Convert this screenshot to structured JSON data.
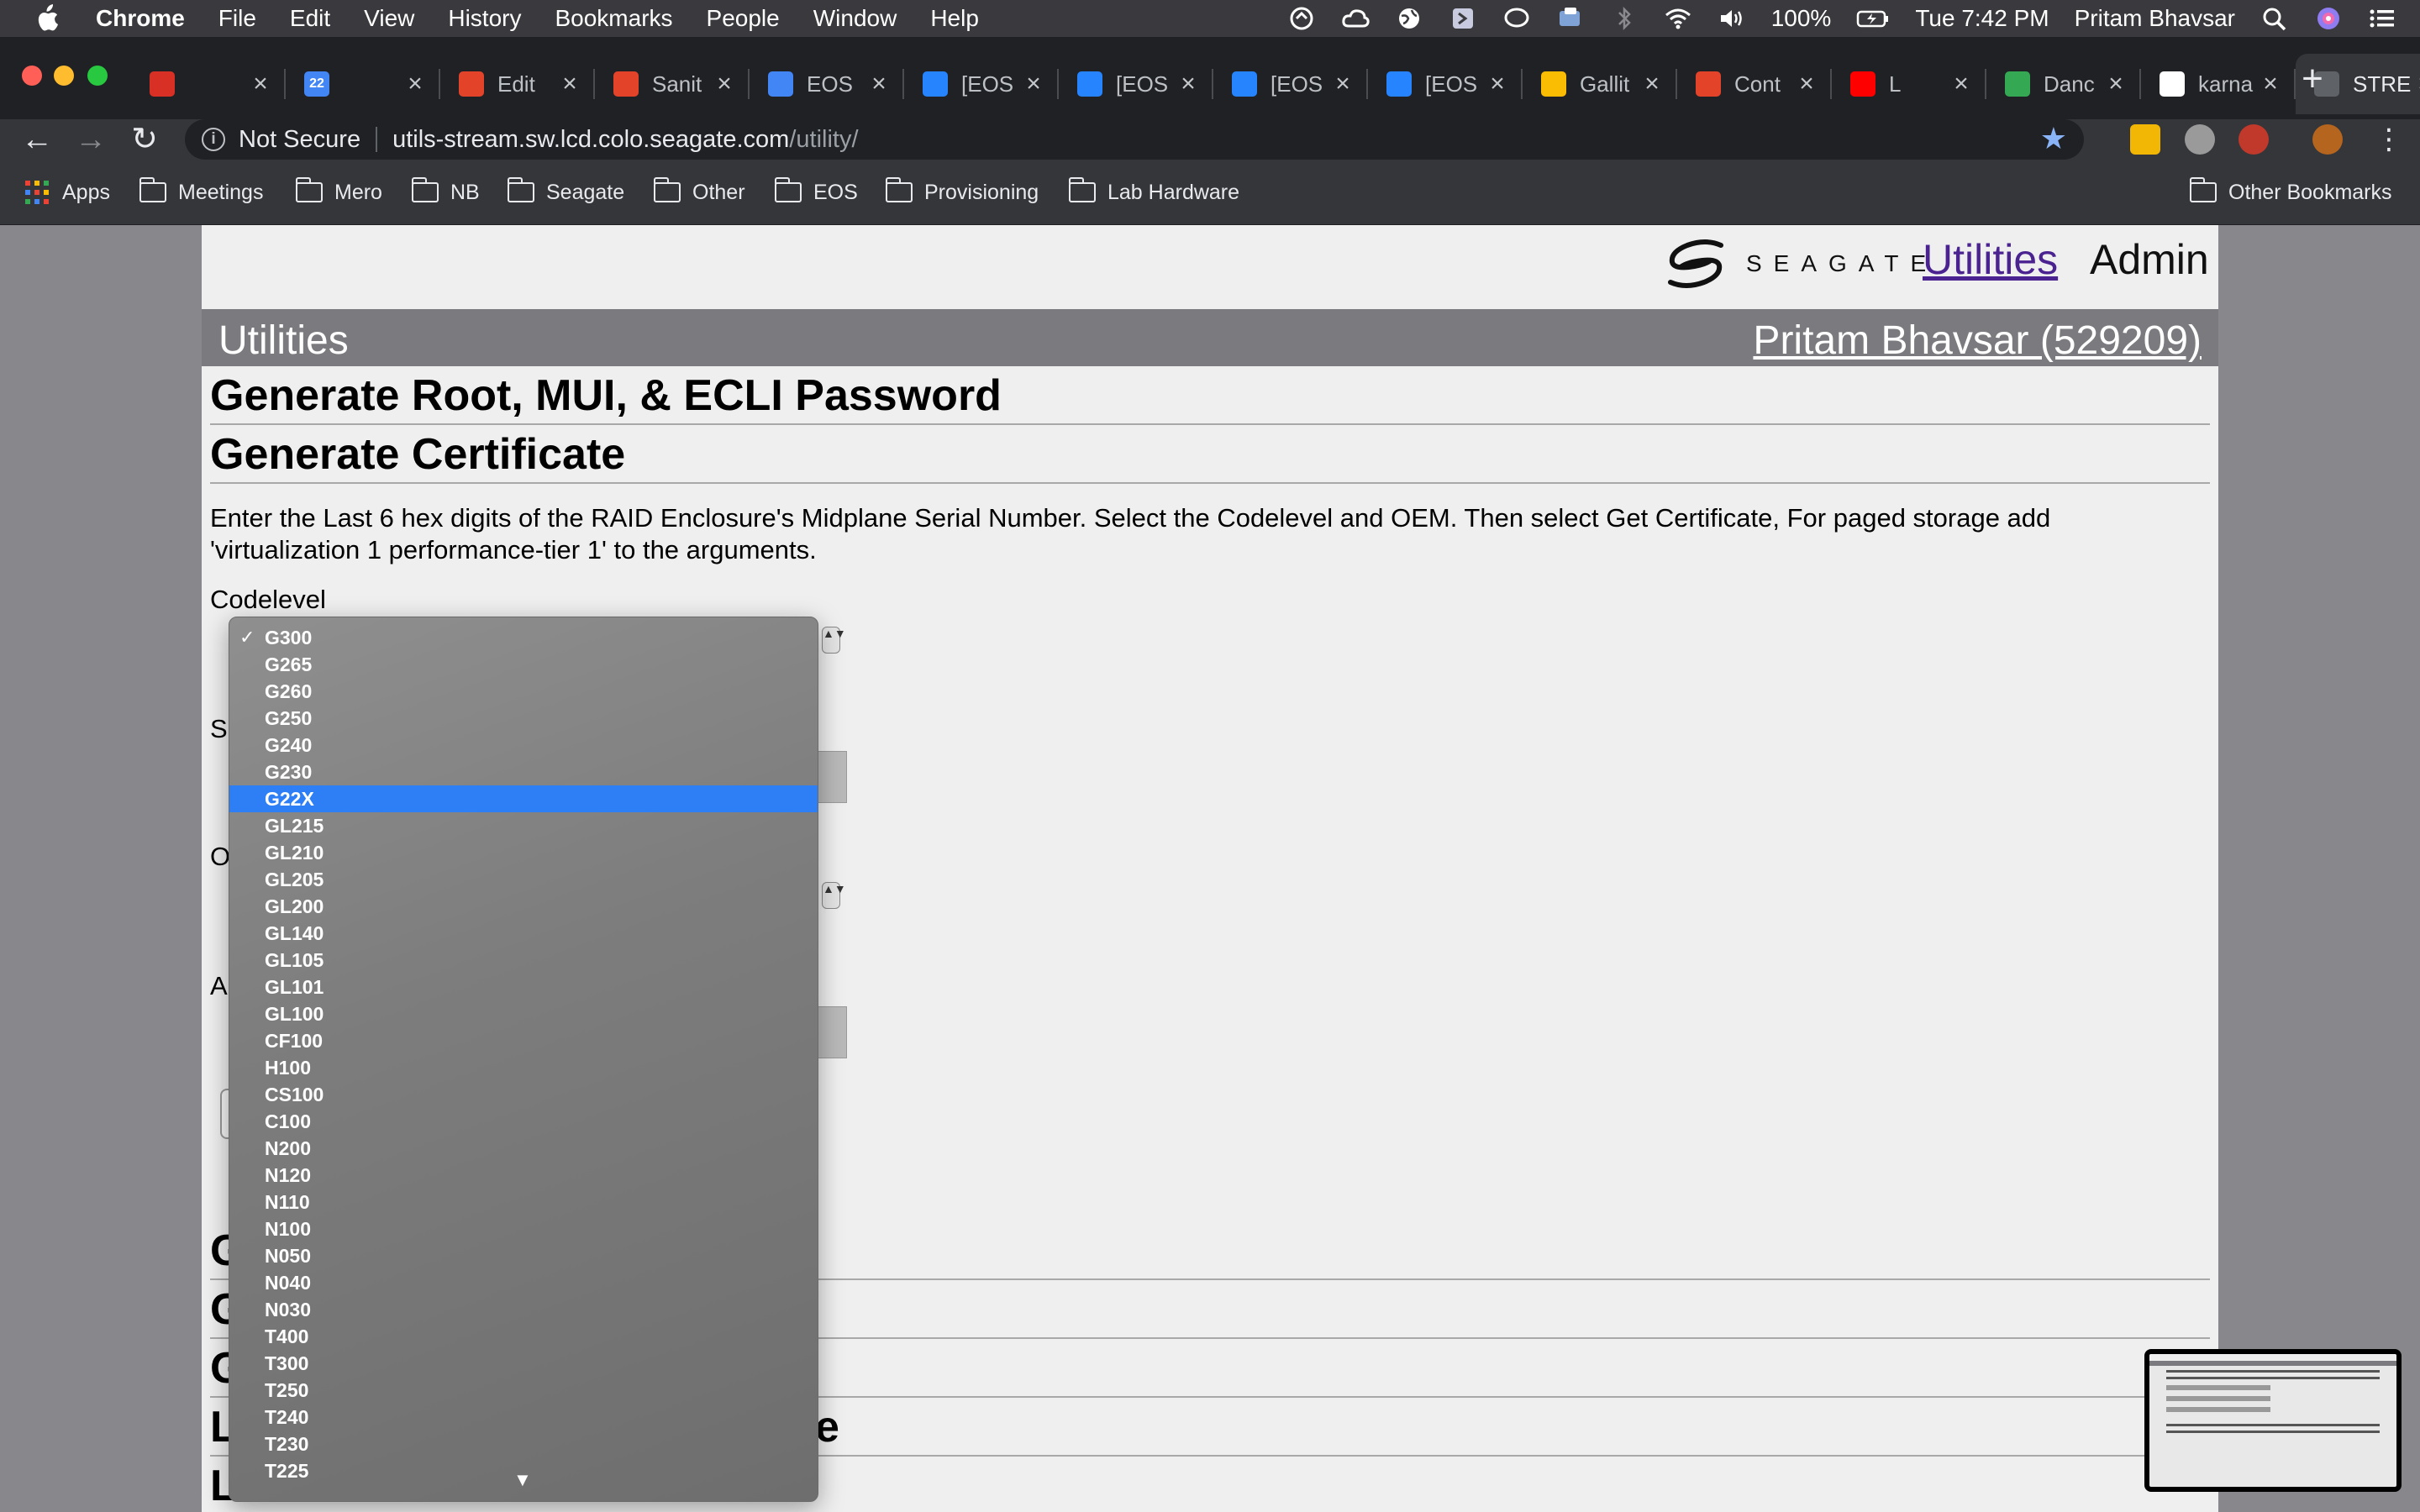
{
  "menubar": {
    "app_name": "Chrome",
    "items": [
      "File",
      "Edit",
      "View",
      "History",
      "Bookmarks",
      "People",
      "Window",
      "Help"
    ],
    "battery": "100%",
    "clock": "Tue 7:42 PM",
    "user": "Pritam Bhavsar"
  },
  "tabs": [
    {
      "title": "",
      "icon": "gmail-icon",
      "color": "#d93025"
    },
    {
      "title": "",
      "icon": "calendar-icon",
      "color": "#4285f4",
      "badge": "22"
    },
    {
      "title": "Edit",
      "icon": "gitlab-icon",
      "color": "#e24329"
    },
    {
      "title": "Sanit",
      "icon": "gitlab-icon",
      "color": "#e24329"
    },
    {
      "title": "EOS",
      "icon": "docs-icon",
      "color": "#4285f4"
    },
    {
      "title": "[EOS",
      "icon": "jira-icon",
      "color": "#2684ff"
    },
    {
      "title": "[EOS",
      "icon": "jira-icon",
      "color": "#2684ff"
    },
    {
      "title": "[EOS",
      "icon": "jira-icon",
      "color": "#2684ff"
    },
    {
      "title": "[EOS",
      "icon": "jira-icon",
      "color": "#2684ff"
    },
    {
      "title": "Gallit",
      "icon": "drive-icon",
      "color": "#fbbc04"
    },
    {
      "title": "Cont",
      "icon": "gitlab-icon",
      "color": "#e24329"
    },
    {
      "title": "L",
      "icon": "youtube-icon",
      "color": "#ff0000"
    },
    {
      "title": "Danc",
      "icon": "maps-icon",
      "color": "#34a853"
    },
    {
      "title": "karna",
      "icon": "google-icon",
      "color": "#ffffff"
    },
    {
      "title": "STRE",
      "icon": "globe-icon",
      "color": "#5f6368",
      "active": true
    }
  ],
  "address_bar": {
    "security": "Not Secure",
    "url_host": "utils-stream.sw.lcd.colo.seagate.com",
    "url_path": "/utility/"
  },
  "bookmarks": {
    "apps": "Apps",
    "folders": [
      "Meetings",
      "Mero",
      "NB",
      "Seagate",
      "Other",
      "EOS",
      "Provisioning",
      "Lab Hardware"
    ],
    "other": "Other Bookmarks"
  },
  "site": {
    "logo_text": "SEAGATE",
    "nav_utilities": "Utilities",
    "nav_admin": "Admin",
    "section_title": "Utilities",
    "user_link": "Pritam Bhavsar (529209)"
  },
  "main": {
    "heading_password": "Generate Root, MUI, & ECLI Password",
    "heading_certificate": "Generate Certificate",
    "description": "Enter the Last 6 hex digits of the RAID Enclosure's Midplane Serial Number. Select the Codelevel and OEM. Then select Get Certificate, For paged storage add 'virtualization 1 performance-tier 1' to the arguments.",
    "codelevel_label": "Codelevel",
    "partial_labels": [
      "S",
      "O",
      "A"
    ],
    "partial_headings": [
      "G",
      "G",
      "G",
      "L",
      "L"
    ],
    "partial_heading_tail": "e"
  },
  "codelevel_dropdown": {
    "selected": "G300",
    "highlighted": "G22X",
    "options": [
      "G300",
      "G265",
      "G260",
      "G250",
      "G240",
      "G230",
      "G22X",
      "GL215",
      "GL210",
      "GL205",
      "GL200",
      "GL140",
      "GL105",
      "GL101",
      "GL100",
      "CF100",
      "H100",
      "CS100",
      "C100",
      "N200",
      "N120",
      "N110",
      "N100",
      "N050",
      "N040",
      "N030",
      "T400",
      "T300",
      "T250",
      "T240",
      "T230",
      "T225"
    ],
    "more_indicator": "▼"
  }
}
